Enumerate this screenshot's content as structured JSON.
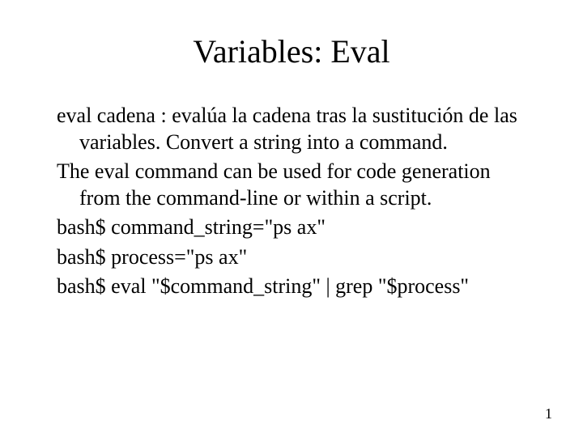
{
  "title": "Variables: Eval",
  "paragraphs": {
    "p1": "eval cadena : evalúa la cadena tras la sustitución de las variables. Convert a string into a command.",
    "p2": "The eval command can be used for code generation from the command-line or within a script.",
    "p3": "bash$ command_string=\"ps ax\"",
    "p4": "bash$ process=\"ps ax\"",
    "p5": "bash$ eval \"$command_string\" | grep \"$process\""
  },
  "page_number": "1"
}
